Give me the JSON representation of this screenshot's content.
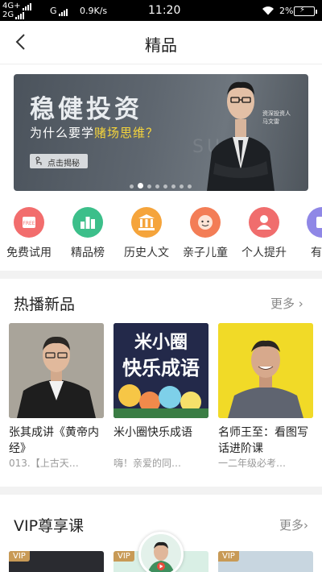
{
  "status": {
    "network1": "4G+",
    "network2": "2G",
    "network3": "G",
    "speed": "0.9K/s",
    "time": "11:20",
    "battery_pct": "2%",
    "wifi_icon": "wifi-icon",
    "battery_icon": "battery-icon"
  },
  "nav": {
    "title": "精品",
    "back_icon": "chevron-left-icon"
  },
  "banner": {
    "headline": "稳健投资",
    "subtitle_prefix": "为什么要学",
    "subtitle_highlight": "赌场思维？",
    "cta": "点击揭秘",
    "role": "资深投资人",
    "person_name": "马文雷",
    "bg_word": "SU                L",
    "slide_count": 8,
    "active_slide": 2,
    "highlight_color": "#f8d63a"
  },
  "categories": [
    {
      "label": "免费试用",
      "icon": "free-tag-icon",
      "color": "#f26d6d"
    },
    {
      "label": "精品榜",
      "icon": "ranking-icon",
      "color": "#3cbf8a"
    },
    {
      "label": "历史人文",
      "icon": "history-icon",
      "color": "#f5a43b"
    },
    {
      "label": "亲子儿童",
      "icon": "child-icon",
      "color": "#f37d56"
    },
    {
      "label": "个人提升",
      "icon": "person-icon",
      "color": "#f06d6d"
    },
    {
      "label": "有声",
      "icon": "audio-icon",
      "color": "#8f87e6"
    }
  ],
  "hot_section": {
    "title": "热播新品",
    "more": "更多",
    "items": [
      {
        "name": "张其成讲《黄帝内经》",
        "desc": "013.【上古天…"
      },
      {
        "name": "米小圈快乐成语",
        "desc": "嗨！亲爱的同…",
        "cover_title1": "米小圈",
        "cover_title2": "快乐成语"
      },
      {
        "name": "名师王至：看图写话进阶课",
        "desc": "一二年级必考…"
      }
    ]
  },
  "vip_section": {
    "title": "VIP尊享课",
    "more": "更多",
    "badge": "VIP"
  }
}
